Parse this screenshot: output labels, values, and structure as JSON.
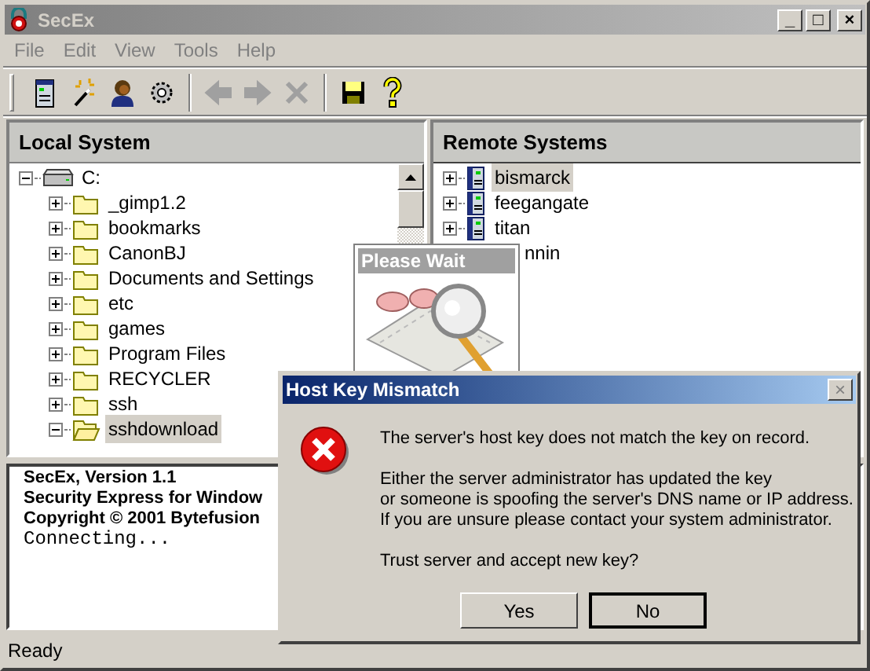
{
  "window": {
    "title": "SecEx",
    "buttons": [
      "_",
      "□",
      "×"
    ]
  },
  "menu": [
    "File",
    "Edit",
    "View",
    "Tools",
    "Help"
  ],
  "toolbar": [
    {
      "kind": "server",
      "disabled": false
    },
    {
      "kind": "wand",
      "disabled": false
    },
    {
      "kind": "person",
      "disabled": false
    },
    {
      "kind": "gear",
      "disabled": false
    },
    {
      "kind": "separator"
    },
    {
      "kind": "back",
      "disabled": true
    },
    {
      "kind": "forward",
      "disabled": true
    },
    {
      "kind": "stop",
      "disabled": true
    },
    {
      "kind": "separator"
    },
    {
      "kind": "save",
      "disabled": false
    },
    {
      "kind": "help",
      "disabled": false
    }
  ],
  "local_panel": {
    "title": "Local System",
    "tree": [
      {
        "label": "C:",
        "kind": "drive",
        "expanded": true,
        "selected": false,
        "children": [
          {
            "label": "_gimp1.2",
            "kind": "folder",
            "expanded": false,
            "selected": false
          },
          {
            "label": "bookmarks",
            "kind": "folder",
            "expanded": false,
            "selected": false
          },
          {
            "label": "CanonBJ",
            "kind": "folder",
            "expanded": false,
            "selected": false
          },
          {
            "label": "Documents and Settings",
            "kind": "folder",
            "expanded": false,
            "selected": false
          },
          {
            "label": "etc",
            "kind": "folder",
            "expanded": false,
            "selected": false
          },
          {
            "label": "games",
            "kind": "folder",
            "expanded": false,
            "selected": false
          },
          {
            "label": "Program Files",
            "kind": "folder",
            "expanded": false,
            "selected": false
          },
          {
            "label": "RECYCLER",
            "kind": "folder",
            "expanded": false,
            "selected": false
          },
          {
            "label": "ssh",
            "kind": "folder",
            "expanded": false,
            "selected": false
          },
          {
            "label": "sshdownload",
            "kind": "folder",
            "expanded": true,
            "selected": true
          }
        ]
      }
    ]
  },
  "remote_panel": {
    "title": "Remote Systems",
    "items": [
      {
        "label": "bismarck",
        "selected": true,
        "obscured": false
      },
      {
        "label": "feegangate",
        "selected": false,
        "obscured": false
      },
      {
        "label": "titan",
        "selected": false,
        "obscured": false
      },
      {
        "label": "nnin",
        "selected": false,
        "obscured": true
      }
    ]
  },
  "log": [
    {
      "text": "SecEx, Version 1.1",
      "kind": "bold"
    },
    {
      "text": "Security Express for Window",
      "kind": "bold"
    },
    {
      "text": "Copyright © 2001 Bytefusion",
      "kind": "bold"
    },
    {
      "text": "Connecting...",
      "kind": "mono"
    }
  ],
  "status_bar": "Ready",
  "wait_window": {
    "title": "Please Wait"
  },
  "dialog": {
    "title": "Host Key Mismatch",
    "close": "×",
    "message": [
      "The server's host key does not match the key on record.",
      "Either the server administrator has updated the key\nor someone is spoofing the server's DNS name or IP address.\nIf you are unsure please contact your system administrator.",
      "Trust server and accept new key?"
    ],
    "buttons": [
      {
        "label": "Yes",
        "default": false
      },
      {
        "label": "No",
        "default": true
      }
    ]
  }
}
